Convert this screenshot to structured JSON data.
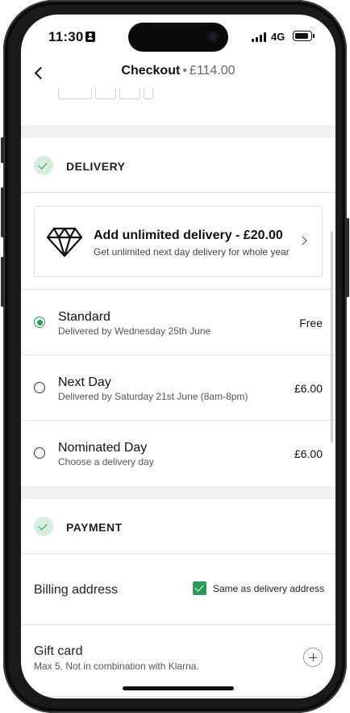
{
  "status_bar": {
    "time": "11:30",
    "network": "4G"
  },
  "header": {
    "title": "Checkout",
    "separator": "•",
    "total": "£114.00"
  },
  "delivery": {
    "section_label": "DELIVERY",
    "promo": {
      "title": "Add unlimited delivery - £20.00",
      "subtitle": "Get unlimited next day delivery for whole year"
    },
    "options": [
      {
        "name": "Standard",
        "description": "Delivered by Wednesday 25th June",
        "price": "Free",
        "selected": true
      },
      {
        "name": "Next Day",
        "description": "Delivered by Saturday 21st June (8am-8pm)",
        "price": "£6.00",
        "selected": false
      },
      {
        "name": "Nominated Day",
        "description": "Choose a delivery day",
        "price": "£6.00",
        "selected": false
      }
    ]
  },
  "payment": {
    "section_label": "PAYMENT",
    "billing": {
      "label": "Billing address",
      "checkbox_label": "Same as delivery address",
      "checked": true
    },
    "gift_card": {
      "label": "Gift card",
      "subtitle": "Max 5. Not in combination with Klarna."
    }
  },
  "colors": {
    "accent_green": "#2a9b57",
    "check_bg": "#d5eede",
    "band_grey": "#f1f1f1"
  },
  "icons": {
    "back": "chevron-left-icon",
    "promo": "diamond-icon",
    "promo_arrow": "chevron-right-icon",
    "gift_add": "plus-icon"
  }
}
